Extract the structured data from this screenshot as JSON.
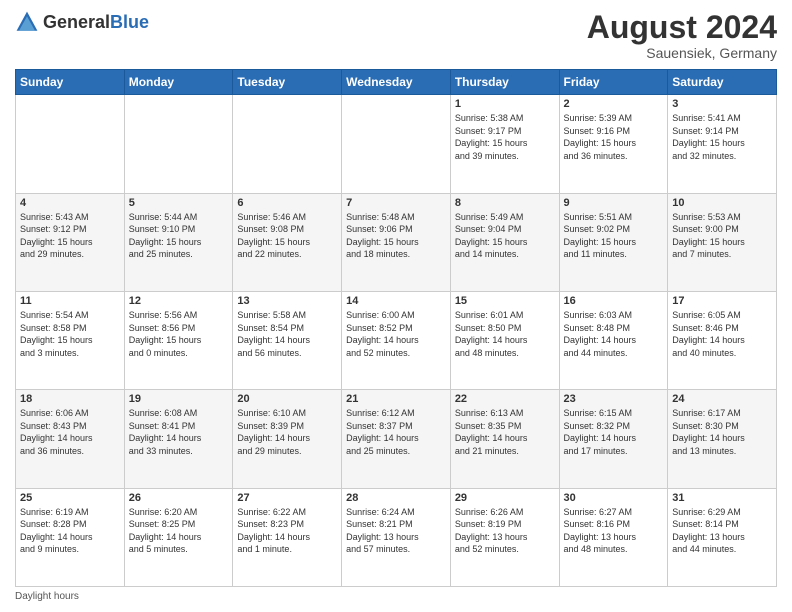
{
  "header": {
    "logo_general": "General",
    "logo_blue": "Blue",
    "month_year": "August 2024",
    "location": "Sauensiek, Germany"
  },
  "weekdays": [
    "Sunday",
    "Monday",
    "Tuesday",
    "Wednesday",
    "Thursday",
    "Friday",
    "Saturday"
  ],
  "weeks": [
    [
      {
        "day": "",
        "info": ""
      },
      {
        "day": "",
        "info": ""
      },
      {
        "day": "",
        "info": ""
      },
      {
        "day": "",
        "info": ""
      },
      {
        "day": "1",
        "info": "Sunrise: 5:38 AM\nSunset: 9:17 PM\nDaylight: 15 hours\nand 39 minutes."
      },
      {
        "day": "2",
        "info": "Sunrise: 5:39 AM\nSunset: 9:16 PM\nDaylight: 15 hours\nand 36 minutes."
      },
      {
        "day": "3",
        "info": "Sunrise: 5:41 AM\nSunset: 9:14 PM\nDaylight: 15 hours\nand 32 minutes."
      }
    ],
    [
      {
        "day": "4",
        "info": "Sunrise: 5:43 AM\nSunset: 9:12 PM\nDaylight: 15 hours\nand 29 minutes."
      },
      {
        "day": "5",
        "info": "Sunrise: 5:44 AM\nSunset: 9:10 PM\nDaylight: 15 hours\nand 25 minutes."
      },
      {
        "day": "6",
        "info": "Sunrise: 5:46 AM\nSunset: 9:08 PM\nDaylight: 15 hours\nand 22 minutes."
      },
      {
        "day": "7",
        "info": "Sunrise: 5:48 AM\nSunset: 9:06 PM\nDaylight: 15 hours\nand 18 minutes."
      },
      {
        "day": "8",
        "info": "Sunrise: 5:49 AM\nSunset: 9:04 PM\nDaylight: 15 hours\nand 14 minutes."
      },
      {
        "day": "9",
        "info": "Sunrise: 5:51 AM\nSunset: 9:02 PM\nDaylight: 15 hours\nand 11 minutes."
      },
      {
        "day": "10",
        "info": "Sunrise: 5:53 AM\nSunset: 9:00 PM\nDaylight: 15 hours\nand 7 minutes."
      }
    ],
    [
      {
        "day": "11",
        "info": "Sunrise: 5:54 AM\nSunset: 8:58 PM\nDaylight: 15 hours\nand 3 minutes."
      },
      {
        "day": "12",
        "info": "Sunrise: 5:56 AM\nSunset: 8:56 PM\nDaylight: 15 hours\nand 0 minutes."
      },
      {
        "day": "13",
        "info": "Sunrise: 5:58 AM\nSunset: 8:54 PM\nDaylight: 14 hours\nand 56 minutes."
      },
      {
        "day": "14",
        "info": "Sunrise: 6:00 AM\nSunset: 8:52 PM\nDaylight: 14 hours\nand 52 minutes."
      },
      {
        "day": "15",
        "info": "Sunrise: 6:01 AM\nSunset: 8:50 PM\nDaylight: 14 hours\nand 48 minutes."
      },
      {
        "day": "16",
        "info": "Sunrise: 6:03 AM\nSunset: 8:48 PM\nDaylight: 14 hours\nand 44 minutes."
      },
      {
        "day": "17",
        "info": "Sunrise: 6:05 AM\nSunset: 8:46 PM\nDaylight: 14 hours\nand 40 minutes."
      }
    ],
    [
      {
        "day": "18",
        "info": "Sunrise: 6:06 AM\nSunset: 8:43 PM\nDaylight: 14 hours\nand 36 minutes."
      },
      {
        "day": "19",
        "info": "Sunrise: 6:08 AM\nSunset: 8:41 PM\nDaylight: 14 hours\nand 33 minutes."
      },
      {
        "day": "20",
        "info": "Sunrise: 6:10 AM\nSunset: 8:39 PM\nDaylight: 14 hours\nand 29 minutes."
      },
      {
        "day": "21",
        "info": "Sunrise: 6:12 AM\nSunset: 8:37 PM\nDaylight: 14 hours\nand 25 minutes."
      },
      {
        "day": "22",
        "info": "Sunrise: 6:13 AM\nSunset: 8:35 PM\nDaylight: 14 hours\nand 21 minutes."
      },
      {
        "day": "23",
        "info": "Sunrise: 6:15 AM\nSunset: 8:32 PM\nDaylight: 14 hours\nand 17 minutes."
      },
      {
        "day": "24",
        "info": "Sunrise: 6:17 AM\nSunset: 8:30 PM\nDaylight: 14 hours\nand 13 minutes."
      }
    ],
    [
      {
        "day": "25",
        "info": "Sunrise: 6:19 AM\nSunset: 8:28 PM\nDaylight: 14 hours\nand 9 minutes."
      },
      {
        "day": "26",
        "info": "Sunrise: 6:20 AM\nSunset: 8:25 PM\nDaylight: 14 hours\nand 5 minutes."
      },
      {
        "day": "27",
        "info": "Sunrise: 6:22 AM\nSunset: 8:23 PM\nDaylight: 14 hours\nand 1 minute."
      },
      {
        "day": "28",
        "info": "Sunrise: 6:24 AM\nSunset: 8:21 PM\nDaylight: 13 hours\nand 57 minutes."
      },
      {
        "day": "29",
        "info": "Sunrise: 6:26 AM\nSunset: 8:19 PM\nDaylight: 13 hours\nand 52 minutes."
      },
      {
        "day": "30",
        "info": "Sunrise: 6:27 AM\nSunset: 8:16 PM\nDaylight: 13 hours\nand 48 minutes."
      },
      {
        "day": "31",
        "info": "Sunrise: 6:29 AM\nSunset: 8:14 PM\nDaylight: 13 hours\nand 44 minutes."
      }
    ]
  ],
  "footer": {
    "daylight_label": "Daylight hours"
  }
}
